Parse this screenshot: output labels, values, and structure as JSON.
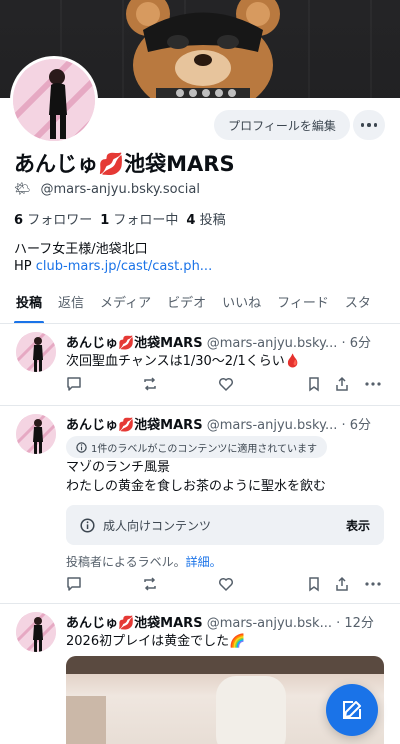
{
  "profile": {
    "display_name": "あんじゅ💋池袋MARS",
    "weather_emoji": "🌤",
    "handle": "@mars-anjyu.bsky.social",
    "followers_count": "6",
    "followers_label": "フォロワー",
    "following_count": "1",
    "following_label": "フォロー中",
    "posts_count": "4",
    "posts_label": "投稿",
    "bio_line1": "ハーフ女王様/池袋北口",
    "bio_link_prefix": "HP",
    "bio_link": "club-mars.jp/cast/cast.ph...",
    "edit_button": "プロフィールを編集"
  },
  "tabs": [
    "投稿",
    "返信",
    "メディア",
    "ビデオ",
    "いいね",
    "フィード",
    "スタ"
  ],
  "posts": [
    {
      "name": "あんじゅ💋池袋MARS",
      "handle": "@mars-anjyu.bsky...",
      "time": "· 6分",
      "text": "次回聖血チャンスは1/30〜2/1くらい🩸"
    },
    {
      "name": "あんじゅ💋池袋MARS",
      "handle": "@mars-anjyu.bsky...",
      "time": "· 6分",
      "label_chip": "1件のラベルがこのコンテンツに適用されています",
      "text_line1": "マゾのランチ風景",
      "text_line2": "わたしの黄金を食しお茶のように聖水を飲む",
      "warning": "成人向けコンテンツ",
      "warning_action": "表示",
      "label_note": "投稿者によるラベル。",
      "label_note_link": "詳細。"
    },
    {
      "name": "あんじゅ💋池袋MARS",
      "handle": "@mars-anjyu.bsk...",
      "time": "· 12分",
      "text": "2026初プレイは黄金でした🌈"
    }
  ],
  "colors": {
    "accent": "#1a73e8",
    "muted_text": "#56606b",
    "chip_bg": "#eef1f5"
  }
}
